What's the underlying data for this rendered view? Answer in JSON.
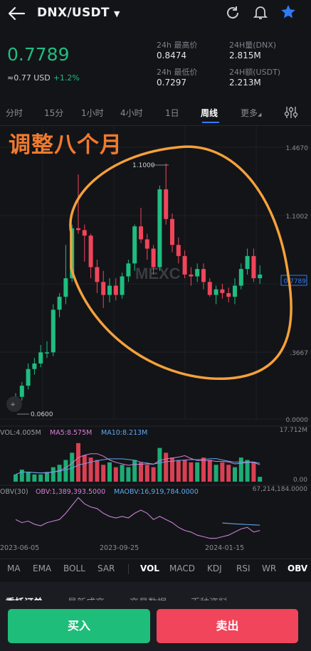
{
  "header": {
    "pair": "DNX/USDT"
  },
  "ticker": {
    "last_price": "0.7789",
    "usd_value": "≈0.77 USD",
    "change": "+1.2%",
    "stats": [
      {
        "label": "24h 最高价",
        "value": "0.8474"
      },
      {
        "label": "24H量(DNX)",
        "value": "2.815M"
      },
      {
        "label": "24h 最低价",
        "value": "0.7297"
      },
      {
        "label": "24H额(USDT)",
        "value": "2.213M"
      }
    ]
  },
  "tabs": [
    "分时",
    "15分",
    "1小时",
    "4小时",
    "1日",
    "周线",
    "更多"
  ],
  "active_tab": "周线",
  "annotation": "调整八个月",
  "chart_data": {
    "type": "candlestick",
    "price_axis": [
      "1.4670",
      "1.1002",
      "0.7789",
      ".3667",
      "0.0000"
    ],
    "max_label": "1.1000",
    "min_label": "0.0600",
    "watermark": "MEXC",
    "x_labels": [
      "2023-06-05",
      "2023-09-25",
      "2024-01-15"
    ],
    "volume_legend": {
      "vol": "VOL:4.005M",
      "ma5": "MA5:8.575M",
      "ma10": "MA10:8.213M"
    },
    "volume_axis": [
      "17.712M",
      "0.00"
    ],
    "obv_legend": {
      "name": "OBV(30)",
      "obv": "OBV:1,389,393.5000",
      "maobv": "MAOBV:16,919,784.0000"
    },
    "obv_axis": "67,214,184.0000",
    "candles": [
      {
        "o": 0.06,
        "h": 0.14,
        "l": 0.05,
        "c": 0.12
      },
      {
        "o": 0.12,
        "h": 0.2,
        "l": 0.1,
        "c": 0.18
      },
      {
        "o": 0.18,
        "h": 0.3,
        "l": 0.16,
        "c": 0.27
      },
      {
        "o": 0.27,
        "h": 0.33,
        "l": 0.24,
        "c": 0.3
      },
      {
        "o": 0.3,
        "h": 0.4,
        "l": 0.28,
        "c": 0.36
      },
      {
        "o": 0.36,
        "h": 0.42,
        "l": 0.33,
        "c": 0.36
      },
      {
        "o": 0.36,
        "h": 0.62,
        "l": 0.34,
        "c": 0.59
      },
      {
        "o": 0.59,
        "h": 0.68,
        "l": 0.55,
        "c": 0.66
      },
      {
        "o": 0.66,
        "h": 0.94,
        "l": 0.62,
        "c": 0.76
      },
      {
        "o": 0.76,
        "h": 1.05,
        "l": 0.74,
        "c": 1.03
      },
      {
        "o": 1.03,
        "h": 1.32,
        "l": 1.0,
        "c": 1.02
      },
      {
        "o": 1.02,
        "h": 1.05,
        "l": 0.85,
        "c": 0.99
      },
      {
        "o": 0.99,
        "h": 1.0,
        "l": 0.76,
        "c": 0.82
      },
      {
        "o": 0.82,
        "h": 0.86,
        "l": 0.68,
        "c": 0.74
      },
      {
        "o": 0.74,
        "h": 0.8,
        "l": 0.6,
        "c": 0.67
      },
      {
        "o": 0.67,
        "h": 0.76,
        "l": 0.63,
        "c": 0.72
      },
      {
        "o": 0.72,
        "h": 0.76,
        "l": 0.64,
        "c": 0.67
      },
      {
        "o": 0.67,
        "h": 0.79,
        "l": 0.65,
        "c": 0.77
      },
      {
        "o": 0.77,
        "h": 0.86,
        "l": 0.74,
        "c": 0.84
      },
      {
        "o": 0.84,
        "h": 1.05,
        "l": 0.8,
        "c": 1.04
      },
      {
        "o": 1.04,
        "h": 1.14,
        "l": 0.95,
        "c": 0.97
      },
      {
        "o": 0.97,
        "h": 1.0,
        "l": 0.86,
        "c": 0.92
      },
      {
        "o": 0.92,
        "h": 0.94,
        "l": 0.78,
        "c": 0.82
      },
      {
        "o": 0.82,
        "h": 1.26,
        "l": 0.8,
        "c": 1.24
      },
      {
        "o": 1.24,
        "h": 1.38,
        "l": 1.05,
        "c": 1.08
      },
      {
        "o": 1.08,
        "h": 1.11,
        "l": 0.9,
        "c": 0.94
      },
      {
        "o": 0.94,
        "h": 0.98,
        "l": 0.84,
        "c": 0.88
      },
      {
        "o": 0.88,
        "h": 0.91,
        "l": 0.76,
        "c": 0.78
      },
      {
        "o": 0.78,
        "h": 0.82,
        "l": 0.72,
        "c": 0.77
      },
      {
        "o": 0.77,
        "h": 0.84,
        "l": 0.74,
        "c": 0.81
      },
      {
        "o": 0.81,
        "h": 0.84,
        "l": 0.7,
        "c": 0.74
      },
      {
        "o": 0.74,
        "h": 0.76,
        "l": 0.66,
        "c": 0.67
      },
      {
        "o": 0.67,
        "h": 0.72,
        "l": 0.62,
        "c": 0.7
      },
      {
        "o": 0.7,
        "h": 0.73,
        "l": 0.65,
        "c": 0.68
      },
      {
        "o": 0.68,
        "h": 0.71,
        "l": 0.63,
        "c": 0.66
      },
      {
        "o": 0.66,
        "h": 0.76,
        "l": 0.62,
        "c": 0.72
      },
      {
        "o": 0.72,
        "h": 0.84,
        "l": 0.7,
        "c": 0.81
      },
      {
        "o": 0.81,
        "h": 0.92,
        "l": 0.78,
        "c": 0.88
      },
      {
        "o": 0.88,
        "h": 0.92,
        "l": 0.74,
        "c": 0.76
      },
      {
        "o": 0.76,
        "h": 0.83,
        "l": 0.73,
        "c": 0.78
      }
    ],
    "volume": [
      3,
      5,
      4,
      3,
      3,
      4,
      6,
      7,
      9,
      12,
      16,
      11,
      10,
      9,
      7,
      8,
      6,
      7,
      6,
      9,
      8,
      7,
      6,
      14,
      12,
      10,
      9,
      9,
      8,
      8,
      10,
      9,
      7,
      8,
      7,
      6,
      10,
      9,
      8,
      2
    ],
    "obv": [
      18,
      16,
      17,
      15,
      14,
      16,
      17,
      18,
      22,
      27,
      32,
      28,
      26,
      25,
      22,
      20,
      19,
      20,
      19,
      22,
      24,
      22,
      18,
      20,
      18,
      16,
      13,
      11,
      10,
      8,
      7,
      6,
      6,
      7,
      8,
      10,
      12,
      13,
      10,
      11
    ],
    "maobv": [
      18,
      18,
      18,
      17,
      17,
      17,
      17,
      17,
      17,
      17,
      16,
      16,
      16,
      16,
      16,
      16,
      16,
      16,
      16,
      16,
      16,
      16,
      16,
      16,
      16,
      16,
      16,
      16,
      16,
      16,
      16,
      16,
      16,
      15.8,
      15.5,
      15.2,
      15,
      14.8,
      14.6,
      14.4
    ]
  },
  "indicators": [
    "MA",
    "EMA",
    "BOLL",
    "SAR",
    "VOL",
    "MACD",
    "KDJ",
    "RSI",
    "WR",
    "OBV"
  ],
  "bottom_tabs": [
    "委托订单",
    "最新成交",
    "交易数据",
    "币种资料"
  ],
  "actions": {
    "buy": "买入",
    "sell": "卖出"
  },
  "colors": {
    "up": "#1fbd80",
    "down": "#f0455a",
    "accent": "#2f7bf5",
    "annotation": "#f5a13a"
  }
}
